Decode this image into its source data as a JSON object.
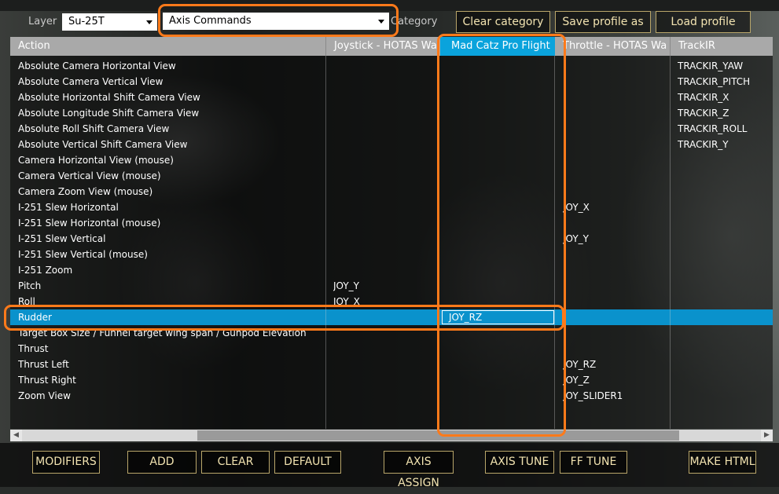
{
  "toolbar": {
    "layer_label": "Layer",
    "layer_value": "Su-25T",
    "category_value": "Axis Commands",
    "category_label": "Category",
    "clear_category": "Clear category",
    "save_profile": "Save profile as",
    "load_profile": "Load profile"
  },
  "columns": [
    "Action",
    "Joystick - HOTAS Wa",
    "Mad Catz Pro Flight",
    "Throttle - HOTAS Wa",
    "TrackIR"
  ],
  "rows": [
    {
      "action": "Absolute Camera Horizontal View",
      "joy": "",
      "mad": "",
      "thr": "",
      "trk": "TRACKIR_YAW"
    },
    {
      "action": "Absolute Camera Vertical View",
      "joy": "",
      "mad": "",
      "thr": "",
      "trk": "TRACKIR_PITCH"
    },
    {
      "action": "Absolute Horizontal Shift Camera View",
      "joy": "",
      "mad": "",
      "thr": "",
      "trk": "TRACKIR_X"
    },
    {
      "action": "Absolute Longitude Shift Camera View",
      "joy": "",
      "mad": "",
      "thr": "",
      "trk": "TRACKIR_Z"
    },
    {
      "action": "Absolute Roll Shift Camera View",
      "joy": "",
      "mad": "",
      "thr": "",
      "trk": "TRACKIR_ROLL"
    },
    {
      "action": "Absolute Vertical Shift Camera View",
      "joy": "",
      "mad": "",
      "thr": "",
      "trk": "TRACKIR_Y"
    },
    {
      "action": "Camera Horizontal View (mouse)",
      "joy": "",
      "mad": "",
      "thr": "",
      "trk": ""
    },
    {
      "action": "Camera Vertical View (mouse)",
      "joy": "",
      "mad": "",
      "thr": "",
      "trk": ""
    },
    {
      "action": "Camera Zoom View (mouse)",
      "joy": "",
      "mad": "",
      "thr": "",
      "trk": ""
    },
    {
      "action": "I-251 Slew Horizontal",
      "joy": "",
      "mad": "",
      "thr": "JOY_X",
      "trk": ""
    },
    {
      "action": "I-251 Slew Horizontal (mouse)",
      "joy": "",
      "mad": "",
      "thr": "",
      "trk": ""
    },
    {
      "action": "I-251 Slew Vertical",
      "joy": "",
      "mad": "",
      "thr": "JOY_Y",
      "trk": ""
    },
    {
      "action": "I-251 Slew Vertical (mouse)",
      "joy": "",
      "mad": "",
      "thr": "",
      "trk": ""
    },
    {
      "action": "I-251 Zoom",
      "joy": "",
      "mad": "",
      "thr": "",
      "trk": ""
    },
    {
      "action": "Pitch",
      "joy": "JOY_Y",
      "mad": "",
      "thr": "",
      "trk": ""
    },
    {
      "action": "Roll",
      "joy": "JOY_X",
      "mad": "",
      "thr": "",
      "trk": ""
    },
    {
      "action": "Rudder",
      "joy": "",
      "mad": "JOY_RZ",
      "thr": "",
      "trk": "",
      "selected": true
    },
    {
      "action": "Target Box Size / Funnel target wing span / Gunpod Elevation",
      "joy": "",
      "mad": "",
      "thr": "",
      "trk": ""
    },
    {
      "action": "Thrust",
      "joy": "",
      "mad": "",
      "thr": "",
      "trk": ""
    },
    {
      "action": "Thrust Left",
      "joy": "",
      "mad": "",
      "thr": "JOY_RZ",
      "trk": ""
    },
    {
      "action": "Thrust Right",
      "joy": "",
      "mad": "",
      "thr": "JOY_Z",
      "trk": ""
    },
    {
      "action": "Zoom View",
      "joy": "",
      "mad": "",
      "thr": "JOY_SLIDER1",
      "trk": ""
    }
  ],
  "bottom": {
    "modifiers": "MODIFIERS",
    "add": "ADD",
    "clear": "CLEAR",
    "default": "DEFAULT",
    "axis_assign": "AXIS ASSIGN",
    "axis_tune": "AXIS TUNE",
    "ff_tune": "FF TUNE",
    "make_html": "MAKE HTML"
  },
  "colors": {
    "accent": "#0aa3dc",
    "selected_row": "#0a92cc",
    "button_border": "#b9a66a",
    "highlight": "#ff7a1a"
  }
}
